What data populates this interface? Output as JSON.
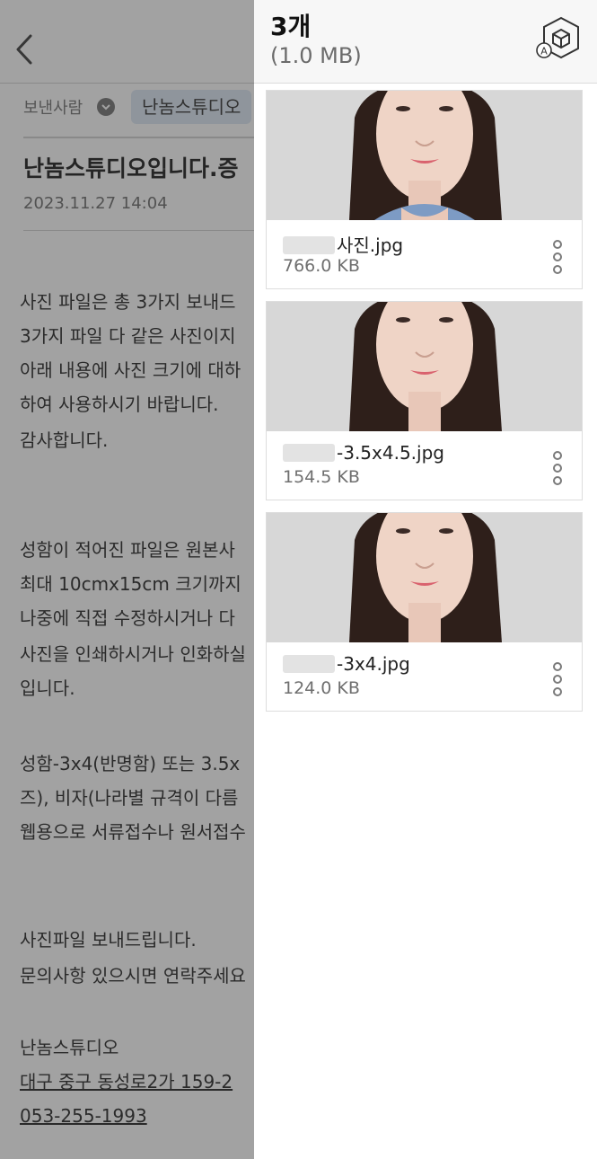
{
  "email": {
    "sender_label": "보낸사람",
    "sender_name": "난놈스튜디오",
    "subject": "난놈스튜디오입니다.증",
    "date": "2023.11.27 14:04",
    "body": [
      {
        "text": "사진 파일은 총 3가지 보내드",
        "underline": false
      },
      {
        "text": "3가지 파일 다 같은 사진이지",
        "underline": false
      },
      {
        "text": "아래 내용에 사진 크기에 대하",
        "underline": false
      },
      {
        "text": "하여 사용하시기 바랍니다.",
        "underline": false
      },
      {
        "text": "감사합니다.",
        "underline": false
      },
      {
        "text": "성함이 적어진 파일은 원본사",
        "underline": false
      },
      {
        "text": "최대 10cmx15cm 크기까지",
        "underline": false
      },
      {
        "text": "나중에 직접 수정하시거나 다",
        "underline": false
      },
      {
        "text": "사진을 인쇄하시거나 인화하실",
        "underline": false
      },
      {
        "text": "입니다.",
        "underline": false
      },
      {
        "text": "성함-3x4(반명함) 또는 3.5x",
        "underline": false
      },
      {
        "text": "즈), 비자(나라별 규격이 다름",
        "underline": false
      },
      {
        "text": "웹용으로 서류접수나 원서접수",
        "underline": false
      },
      {
        "text": "사진파일 보내드립니다.",
        "underline": false
      },
      {
        "text": "문의사항 있으시면 연락주세요",
        "underline": false
      },
      {
        "text": "난놈스튜디오",
        "underline": false
      },
      {
        "text": "대구 중구 동성로2가 159-2",
        "underline": true
      },
      {
        "text": "053-255-1993",
        "underline": true
      }
    ]
  },
  "attachments": {
    "count": "3개",
    "total_size": "(1.0 MB)",
    "ar_icon": "ar-cube-icon",
    "files": [
      {
        "name_visible": "사진.jpg",
        "size": "766.0 KB",
        "sweater_color": "#7d9bc4"
      },
      {
        "name_visible": "-3.5x4.5.jpg",
        "size": "154.5 KB",
        "sweater_color": ""
      },
      {
        "name_visible": "-3x4.jpg",
        "size": "124.0 KB",
        "sweater_color": ""
      }
    ]
  },
  "colors": {
    "overlay": "#5e5e5e",
    "sender_chip": "#dbe6f3"
  }
}
